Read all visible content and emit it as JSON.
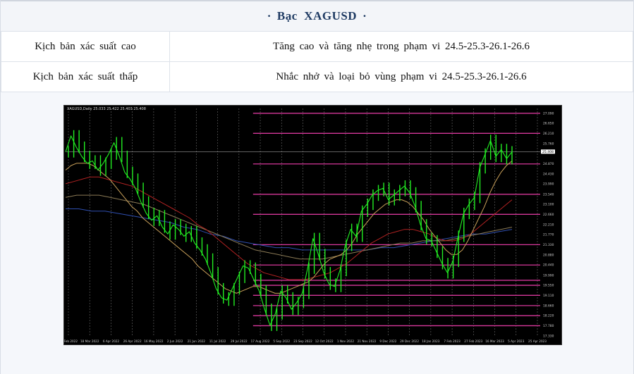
{
  "title": {
    "prefix_dot": "·",
    "text": "Bạc  XAGUSD",
    "suffix_dot": "·"
  },
  "scenarios": [
    {
      "label": "Kịch bản xác suất cao",
      "value": "Tăng cao và tăng nhẹ trong phạm vi 24.5-25.3-26.1-26.6"
    },
    {
      "label": "Kịch bản xác suất thấp",
      "value": "Nhắc nhở và loại bỏ vùng phạm vi 24.5-25.3-26.1-26.6"
    }
  ],
  "chart_data": {
    "type": "line",
    "header": "XAGUSD,Daily 25.033 25.422 25.403 25.408",
    "price_labels": [
      "27.090",
      "26.650",
      "26.210",
      "25.760",
      "25.408",
      "24.870",
      "24.430",
      "23.990",
      "23.540",
      "23.100",
      "22.660",
      "22.210",
      "21.770",
      "21.330",
      "20.880",
      "20.440",
      "19.990",
      "19.550",
      "19.110",
      "18.660",
      "18.220",
      "17.780",
      "17.330"
    ],
    "x_labels": [
      "18 Feb 2022",
      "18 Mar 2022",
      "6 Apr 2022",
      "26 Apr 2022",
      "16 May 2022",
      "2 Jun 2022",
      "21 Jun 2022",
      "11 Jul 2022",
      "29 Jul 2022",
      "17 Aug 2022",
      "5 Sep 2022",
      "23 Sep 2022",
      "12 Oct 2022",
      "1 Nov 2022",
      "21 Nov 2022",
      "9 Dec 2022",
      "29 Dec 2022",
      "18 Jan 2023",
      "7 Feb 2023",
      "27 Feb 2023",
      "16 Mar 2023",
      "5 Apr 2023",
      "25 Apr 2023"
    ],
    "ylim": [
      17.33,
      27.3
    ],
    "current_price": 25.408,
    "close": [
      25.4,
      26.1,
      25.6,
      25.2,
      24.9,
      25.0,
      24.6,
      24.9,
      25.3,
      25.8,
      25.2,
      24.5,
      24.2,
      23.8,
      23.2,
      22.7,
      22.4,
      22.6,
      22.1,
      21.8,
      22.2,
      22.0,
      21.7,
      21.9,
      21.4,
      21.1,
      20.7,
      20.1,
      19.4,
      19.0,
      18.9,
      19.4,
      19.9,
      20.4,
      20.3,
      19.8,
      19.3,
      18.5,
      17.8,
      18.3,
      19.3,
      19.0,
      18.5,
      18.8,
      19.2,
      20.3,
      21.6,
      20.9,
      20.1,
      19.6,
      19.5,
      20.2,
      21.3,
      22.0,
      21.7,
      22.8,
      23.1,
      23.5,
      23.7,
      23.8,
      23.3,
      23.5,
      23.7,
      23.9,
      23.6,
      23.0,
      22.2,
      21.6,
      21.5,
      21.0,
      20.5,
      20.1,
      20.6,
      21.7,
      22.7,
      23.1,
      23.4,
      24.7,
      25.3,
      25.9,
      25.2,
      25.5,
      25.1,
      25.4
    ],
    "ma_fast": [
      24.6,
      24.8,
      24.9,
      24.9,
      24.9,
      24.8,
      24.6,
      24.4,
      24.2,
      23.9,
      23.6,
      23.3,
      23.0,
      22.8,
      22.5,
      22.3,
      22.1,
      21.9,
      21.7,
      21.5,
      21.3,
      21.1,
      20.9,
      20.7,
      20.4,
      20.2,
      20.0,
      19.8,
      19.6,
      19.4,
      19.3,
      19.2,
      19.3,
      19.4,
      19.5,
      19.5,
      19.4,
      19.3,
      19.2,
      19.2,
      19.3,
      19.4,
      19.5,
      19.6,
      19.7,
      19.9,
      20.2,
      20.5,
      20.7,
      20.8,
      20.9,
      21.1,
      21.4,
      21.8,
      22.1,
      22.4,
      22.7,
      22.9,
      23.1,
      23.2,
      23.3,
      23.3,
      23.2,
      23.0,
      22.7,
      22.4,
      22.0,
      21.7,
      21.4,
      21.1,
      20.9,
      20.9,
      21.1,
      21.5,
      22.0,
      22.5,
      23.0,
      23.6,
      24.1,
      24.5,
      24.8,
      25.0
    ],
    "ma_mid": [
      24.0,
      24.1,
      24.2,
      24.3,
      24.3,
      24.2,
      24.1,
      24.0,
      23.9,
      23.7,
      23.5,
      23.3,
      23.1,
      22.9,
      22.7,
      22.5,
      22.2,
      22.0,
      21.7,
      21.4,
      21.1,
      20.8,
      20.5,
      20.3,
      20.1,
      20.0,
      19.9,
      19.8,
      19.8,
      19.8,
      19.9,
      20.0,
      20.1,
      20.3,
      20.5,
      20.8,
      21.1,
      21.4,
      21.6,
      21.8,
      21.9,
      22.0,
      22.0,
      21.9,
      21.8,
      21.6,
      21.5,
      21.5,
      21.6,
      21.8,
      22.1,
      22.4,
      22.7,
      23.0,
      23.3
    ],
    "ma_slow": [
      23.4,
      23.5,
      23.5,
      23.5,
      23.4,
      23.3,
      23.2,
      23.1,
      22.9,
      22.7,
      22.5,
      22.3,
      22.1,
      21.9,
      21.7,
      21.5,
      21.3,
      21.1,
      21.0,
      20.9,
      20.8,
      20.7,
      20.7,
      20.7,
      20.8,
      20.9,
      21.0,
      21.1,
      21.2,
      21.3,
      21.4,
      21.4,
      21.5,
      21.5,
      21.5,
      21.6,
      21.7,
      21.8,
      21.9,
      22.0,
      22.1
    ],
    "ma_long": [
      22.9,
      22.9,
      22.8,
      22.8,
      22.7,
      22.6,
      22.5,
      22.4,
      22.3,
      22.1,
      22.0,
      21.8,
      21.7,
      21.5,
      21.4,
      21.3,
      21.2,
      21.2,
      21.1,
      21.1,
      21.1,
      21.1,
      21.1,
      21.1,
      21.2,
      21.2,
      21.3,
      21.4,
      21.5,
      21.6,
      21.7,
      21.8,
      21.8,
      21.9,
      22.0
    ],
    "fib_levels": [
      27.09,
      26.21,
      24.87,
      23.54,
      22.66,
      21.33,
      20.44,
      19.77,
      19.55,
      19.11,
      18.66,
      18.22,
      17.78
    ],
    "colors": {
      "price": "#22ee22",
      "ma_fast": "#caa15a",
      "ma_mid": "#b22222",
      "ma_slow": "#8b7a55",
      "ma_long": "#2f4fb0",
      "fib": "#d6379a"
    }
  }
}
